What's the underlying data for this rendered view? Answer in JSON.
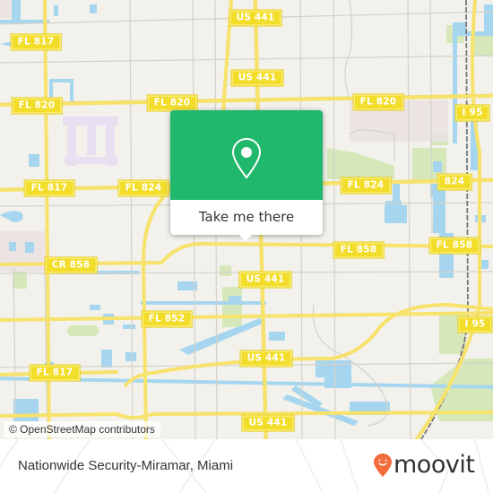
{
  "map": {
    "region": "Miami",
    "colors": {
      "land": "#f2f1ec",
      "road_major": "#f7e26b",
      "road_minor": "#d6d4cc",
      "water": "#a6d6ef",
      "park": "#d4e6b5",
      "rail": "#7a7a7a",
      "shield_bg": "#f3dd2b"
    },
    "road_labels": [
      {
        "id": "fl817-top",
        "text": "FL 817"
      },
      {
        "id": "us441-top",
        "text": "US 441"
      },
      {
        "id": "us441-2",
        "text": "US 441"
      },
      {
        "id": "fl820-left",
        "text": "FL 820"
      },
      {
        "id": "fl820-mid",
        "text": "FL 820"
      },
      {
        "id": "fl820-right",
        "text": "FL 820"
      },
      {
        "id": "i95-top",
        "text": "I 95"
      },
      {
        "id": "fl817-mid",
        "text": "FL 817"
      },
      {
        "id": "fl824-left",
        "text": "FL 824"
      },
      {
        "id": "fl824-right",
        "text": "FL 824"
      },
      {
        "id": "r824",
        "text": "824"
      },
      {
        "id": "cr858",
        "text": "CR 858"
      },
      {
        "id": "fl858-mid",
        "text": "FL 858"
      },
      {
        "id": "fl858-right",
        "text": "FL 858"
      },
      {
        "id": "us441-3",
        "text": "US 441"
      },
      {
        "id": "fl852",
        "text": "FL 852"
      },
      {
        "id": "i95-bottom",
        "text": "I 95"
      },
      {
        "id": "us441-4",
        "text": "US 441"
      },
      {
        "id": "fl817-bottom",
        "text": "FL 817"
      },
      {
        "id": "us441-5",
        "text": "US 441"
      }
    ],
    "attribution": "© OpenStreetMap contributors"
  },
  "popup": {
    "icon": "map-pin-icon",
    "button_label": "Take me there",
    "accent_color": "#1fb86c"
  },
  "footer": {
    "place_title": "Nationwide Security-Miramar, Miami",
    "logo_text": "moovit",
    "logo_icon": "moovit-smiley-pin-icon",
    "logo_color": "#f26b3a"
  }
}
